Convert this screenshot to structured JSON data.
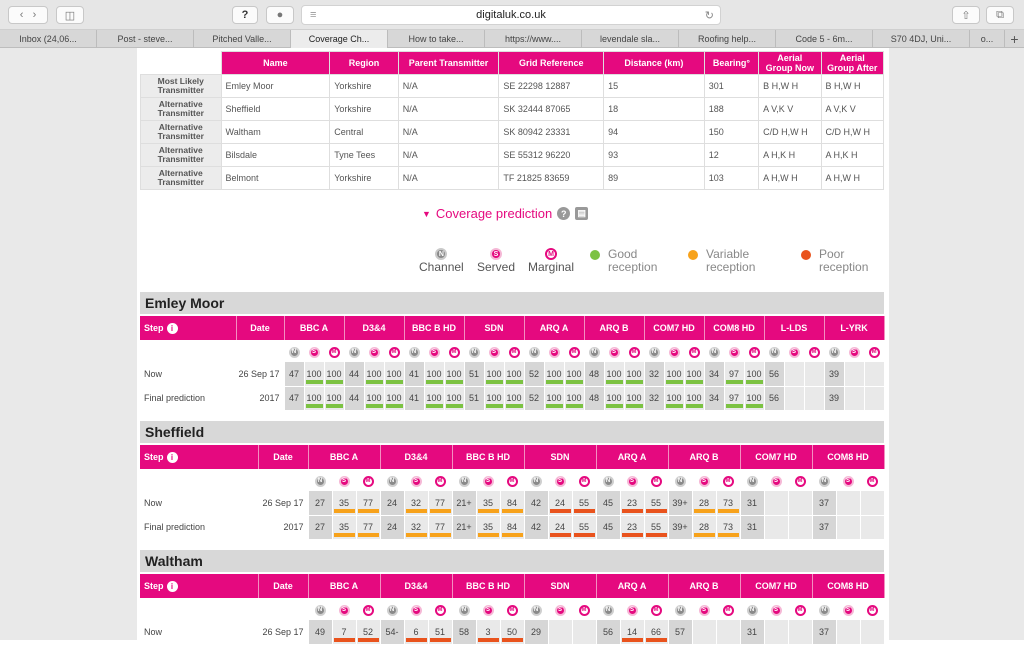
{
  "browser": {
    "url": "digitaluk.co.uk",
    "tabs": [
      "Inbox (24,06...",
      "Post - steve...",
      "Pitched Valle...",
      "Coverage Ch...",
      "How to take...",
      "https://www....",
      "levendale sla...",
      "Roofing help...",
      "Code 5 - 6m...",
      "S70 4DJ, Uni...",
      "o..."
    ]
  },
  "transmitters": {
    "headers": [
      "Name",
      "Region",
      "Parent Transmitter",
      "Grid Reference",
      "Distance (km)",
      "Bearing°",
      "Aerial Group Now",
      "Aerial Group After"
    ],
    "rows": [
      {
        "type": "Most Likely Transmitter",
        "cells": [
          "Emley Moor",
          "Yorkshire",
          "N/A",
          "SE 22298 12887",
          "15",
          "301",
          "B H,W H",
          "B H,W H"
        ]
      },
      {
        "type": "Alternative Transmitter",
        "cells": [
          "Sheffield",
          "Yorkshire",
          "N/A",
          "SK 32444 87065",
          "18",
          "188",
          "A V,K V",
          "A V,K V"
        ]
      },
      {
        "type": "Alternative Transmitter",
        "cells": [
          "Waltham",
          "Central",
          "N/A",
          "SK 80942 23331",
          "94",
          "150",
          "C/D H,W H",
          "C/D H,W H"
        ]
      },
      {
        "type": "Alternative Transmitter",
        "cells": [
          "Bilsdale",
          "Tyne Tees",
          "N/A",
          "SE 55312 96220",
          "93",
          "12",
          "A H,K H",
          "A H,K H"
        ]
      },
      {
        "type": "Alternative Transmitter",
        "cells": [
          "Belmont",
          "Yorkshire",
          "N/A",
          "TF 21825 83659",
          "89",
          "103",
          "A H,W H",
          "A H,W H"
        ]
      }
    ]
  },
  "coverage": {
    "title": "Coverage prediction",
    "help_label": "?"
  },
  "legend": {
    "channel": "Channel",
    "served": "Served",
    "marginal": "Marginal",
    "good": "Good reception",
    "variable": "Variable reception",
    "poor": "Poor reception",
    "channel_glyph": "N",
    "served_glyph": "S",
    "marginal_glyph": "M",
    "colors": {
      "good": "#7cc242",
      "variable": "#f7a21b",
      "poor": "#e9531d"
    }
  },
  "sections": [
    {
      "name": "Emley Moor",
      "step": "Step",
      "date": "Date",
      "info": "i",
      "muxes": [
        "BBC A",
        "D3&4",
        "BBC B HD",
        "SDN",
        "ARQ A",
        "ARQ B",
        "COM7 HD",
        "COM8 HD",
        "L-LDS",
        "L-YRK"
      ],
      "rows": [
        {
          "label": "Now",
          "date": "26 Sep 17",
          "cells": [
            [
              "47",
              ""
            ],
            [
              "100",
              "g"
            ],
            [
              "100",
              "g"
            ],
            [
              "44",
              ""
            ],
            [
              "100",
              "g"
            ],
            [
              "100",
              "g"
            ],
            [
              "41",
              ""
            ],
            [
              "100",
              "g"
            ],
            [
              "100",
              "g"
            ],
            [
              "51",
              ""
            ],
            [
              "100",
              "g"
            ],
            [
              "100",
              "g"
            ],
            [
              "52",
              ""
            ],
            [
              "100",
              "g"
            ],
            [
              "100",
              "g"
            ],
            [
              "48",
              ""
            ],
            [
              "100",
              "g"
            ],
            [
              "100",
              "g"
            ],
            [
              "32",
              ""
            ],
            [
              "100",
              "g"
            ],
            [
              "100",
              "g"
            ],
            [
              "34",
              ""
            ],
            [
              "97",
              "g"
            ],
            [
              "100",
              "g"
            ],
            [
              "56",
              ""
            ],
            [
              "",
              ""
            ],
            [
              "",
              ""
            ],
            [
              "39",
              ""
            ],
            [
              "",
              ""
            ],
            [
              "",
              ""
            ]
          ]
        },
        {
          "label": "Final prediction",
          "date": "2017",
          "cells": [
            [
              "47",
              ""
            ],
            [
              "100",
              "g"
            ],
            [
              "100",
              "g"
            ],
            [
              "44",
              ""
            ],
            [
              "100",
              "g"
            ],
            [
              "100",
              "g"
            ],
            [
              "41",
              ""
            ],
            [
              "100",
              "g"
            ],
            [
              "100",
              "g"
            ],
            [
              "51",
              ""
            ],
            [
              "100",
              "g"
            ],
            [
              "100",
              "g"
            ],
            [
              "52",
              ""
            ],
            [
              "100",
              "g"
            ],
            [
              "100",
              "g"
            ],
            [
              "48",
              ""
            ],
            [
              "100",
              "g"
            ],
            [
              "100",
              "g"
            ],
            [
              "32",
              ""
            ],
            [
              "100",
              "g"
            ],
            [
              "100",
              "g"
            ],
            [
              "34",
              ""
            ],
            [
              "97",
              "g"
            ],
            [
              "100",
              "g"
            ],
            [
              "56",
              ""
            ],
            [
              "",
              ""
            ],
            [
              "",
              ""
            ],
            [
              "39",
              ""
            ],
            [
              "",
              ""
            ],
            [
              "",
              ""
            ]
          ]
        }
      ]
    },
    {
      "name": "Sheffield",
      "step": "Step",
      "date": "Date",
      "info": "i",
      "muxes": [
        "BBC A",
        "D3&4",
        "BBC B HD",
        "SDN",
        "ARQ A",
        "ARQ B",
        "COM7 HD",
        "COM8 HD"
      ],
      "rows": [
        {
          "label": "Now",
          "date": "26 Sep 17",
          "cells": [
            [
              "27",
              ""
            ],
            [
              "35",
              "o"
            ],
            [
              "77",
              "o"
            ],
            [
              "24",
              ""
            ],
            [
              "32",
              "o"
            ],
            [
              "77",
              "o"
            ],
            [
              "21+",
              ""
            ],
            [
              "35",
              "o"
            ],
            [
              "84",
              "o"
            ],
            [
              "42",
              ""
            ],
            [
              "24",
              "r"
            ],
            [
              "55",
              "r"
            ],
            [
              "45",
              ""
            ],
            [
              "23",
              "r"
            ],
            [
              "55",
              "r"
            ],
            [
              "39+",
              ""
            ],
            [
              "28",
              "o"
            ],
            [
              "73",
              "o"
            ],
            [
              "31",
              ""
            ],
            [
              "",
              ""
            ],
            [
              "",
              ""
            ],
            [
              "37",
              ""
            ],
            [
              "",
              ""
            ],
            [
              "",
              ""
            ]
          ]
        },
        {
          "label": "Final prediction",
          "date": "2017",
          "cells": [
            [
              "27",
              ""
            ],
            [
              "35",
              "o"
            ],
            [
              "77",
              "o"
            ],
            [
              "24",
              ""
            ],
            [
              "32",
              "o"
            ],
            [
              "77",
              "o"
            ],
            [
              "21+",
              ""
            ],
            [
              "35",
              "o"
            ],
            [
              "84",
              "o"
            ],
            [
              "42",
              ""
            ],
            [
              "24",
              "r"
            ],
            [
              "55",
              "r"
            ],
            [
              "45",
              ""
            ],
            [
              "23",
              "r"
            ],
            [
              "55",
              "r"
            ],
            [
              "39+",
              ""
            ],
            [
              "28",
              "o"
            ],
            [
              "73",
              "o"
            ],
            [
              "31",
              ""
            ],
            [
              "",
              ""
            ],
            [
              "",
              ""
            ],
            [
              "37",
              ""
            ],
            [
              "",
              ""
            ],
            [
              "",
              ""
            ]
          ]
        }
      ]
    },
    {
      "name": "Waltham",
      "step": "Step",
      "date": "Date",
      "info": "i",
      "muxes": [
        "BBC A",
        "D3&4",
        "BBC B HD",
        "SDN",
        "ARQ A",
        "ARQ B",
        "COM7 HD",
        "COM8 HD"
      ],
      "rows": [
        {
          "label": "Now",
          "date": "26 Sep 17",
          "cells": [
            [
              "49",
              ""
            ],
            [
              "7",
              "r"
            ],
            [
              "52",
              "r"
            ],
            [
              "54-",
              ""
            ],
            [
              "6",
              "r"
            ],
            [
              "51",
              "r"
            ],
            [
              "58",
              ""
            ],
            [
              "3",
              "r"
            ],
            [
              "50",
              "r"
            ],
            [
              "29",
              ""
            ],
            [
              "",
              ""
            ],
            [
              "",
              ""
            ],
            [
              "56",
              ""
            ],
            [
              "14",
              "r"
            ],
            [
              "66",
              "r"
            ],
            [
              "57",
              ""
            ],
            [
              "",
              ""
            ],
            [
              "",
              ""
            ],
            [
              "31",
              ""
            ],
            [
              "",
              ""
            ],
            [
              "",
              ""
            ],
            [
              "37",
              ""
            ],
            [
              "",
              ""
            ],
            [
              "",
              ""
            ]
          ]
        }
      ]
    }
  ]
}
